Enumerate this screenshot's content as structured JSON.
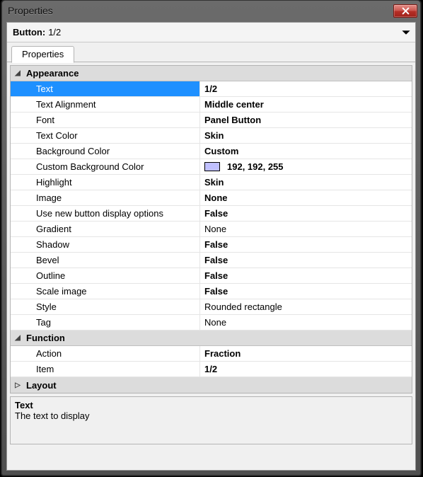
{
  "window": {
    "title": "Properties"
  },
  "selector": {
    "label": "Button:",
    "value": "1/2"
  },
  "tabs": {
    "active": "Properties"
  },
  "categories": {
    "appearance": {
      "label": "Appearance",
      "expanded": true
    },
    "function": {
      "label": "Function",
      "expanded": true
    },
    "layout": {
      "label": "Layout",
      "expanded": false
    }
  },
  "props": {
    "text": {
      "name": "Text",
      "value": "1/2",
      "bold": true,
      "selected": true
    },
    "textAlign": {
      "name": "Text Alignment",
      "value": "Middle center",
      "bold": true
    },
    "font": {
      "name": "Font",
      "value": "Panel Button",
      "bold": true
    },
    "textColor": {
      "name": "Text Color",
      "value": "Skin",
      "bold": true
    },
    "bgColor": {
      "name": "Background Color",
      "value": "Custom",
      "bold": true
    },
    "customBg": {
      "name": "Custom Background Color",
      "value": "192, 192, 255",
      "swatch": "#c0c0ff",
      "bold": true
    },
    "highlight": {
      "name": "Highlight",
      "value": "Skin",
      "bold": true
    },
    "image": {
      "name": "Image",
      "value": "None",
      "bold": true
    },
    "useNewBtn": {
      "name": "Use new button display options",
      "value": "False",
      "bold": true
    },
    "gradient": {
      "name": "Gradient",
      "value": "None",
      "bold": false
    },
    "shadow": {
      "name": "Shadow",
      "value": "False",
      "bold": true
    },
    "bevel": {
      "name": "Bevel",
      "value": "False",
      "bold": true
    },
    "outline": {
      "name": "Outline",
      "value": "False",
      "bold": true
    },
    "scaleImage": {
      "name": "Scale image",
      "value": "False",
      "bold": true
    },
    "style": {
      "name": "Style",
      "value": "Rounded rectangle",
      "bold": false
    },
    "tag": {
      "name": "Tag",
      "value": "None",
      "bold": false
    },
    "action": {
      "name": "Action",
      "value": "Fraction",
      "bold": true
    },
    "item": {
      "name": "Item",
      "value": "1/2",
      "bold": true
    }
  },
  "description": {
    "title": "Text",
    "body": "The text to display"
  }
}
